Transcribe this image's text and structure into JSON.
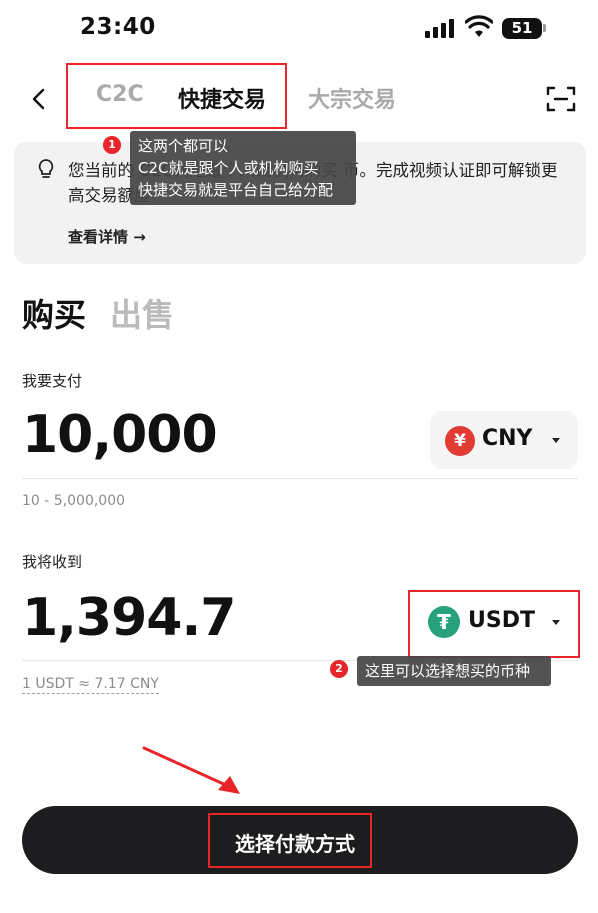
{
  "status_bar": {
    "time": "23:40",
    "battery": "51"
  },
  "header": {
    "tabs": [
      {
        "label": "C2C",
        "active": false
      },
      {
        "label": "快捷交易",
        "active": true
      },
      {
        "label": "大宗交易",
        "active": false
      }
    ]
  },
  "banner": {
    "text": "您当前的 C2C就是跟个人或机构购买 币。完成视频认证即可解锁更高交易额度",
    "detail_label": "查看详情 →"
  },
  "annotations": [
    {
      "number": "1",
      "lines": [
        "这两个都可以",
        "C2C就是跟个人或机构购买",
        "快捷交易就是平台自己给分配"
      ]
    },
    {
      "number": "2",
      "lines": [
        "这里可以选择想买的币种"
      ]
    }
  ],
  "mode": {
    "buy_label": "购买",
    "sell_label": "出售"
  },
  "pay": {
    "label": "我要支付",
    "amount": "10,000",
    "currency": "CNY",
    "currency_symbol": "¥",
    "range": "10 - 5,000,000"
  },
  "receive": {
    "label": "我将收到",
    "amount": "1,394.7",
    "currency": "USDT",
    "currency_symbol": "₮",
    "rate": "1 USDT ≈ 7.17 CNY"
  },
  "action": {
    "label": "选择付款方式"
  },
  "colors": {
    "accent_red": "#e8262a",
    "usdt_green": "#26a17b",
    "cny_red": "#e23b32",
    "button_dark": "#1d1d1f"
  },
  "icons": [
    "back-arrow-icon",
    "scan-icon",
    "lightbulb-icon",
    "cny-icon",
    "usdt-icon",
    "caret-down-icon",
    "signal-icon",
    "wifi-icon",
    "battery-icon"
  ]
}
